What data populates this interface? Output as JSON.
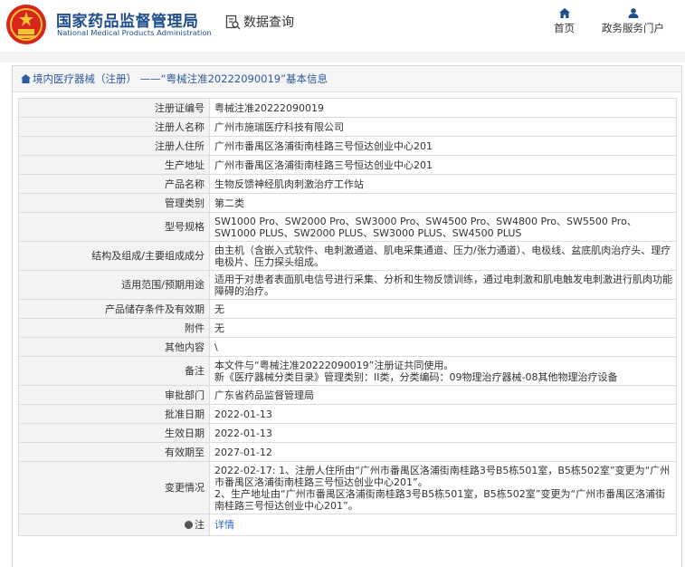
{
  "header": {
    "org_name_cn": "国家药品监督管理局",
    "org_name_en": "National Medical Products Administration",
    "search_label": "数据查询",
    "nav": [
      {
        "label": "首页",
        "icon": "home-icon"
      },
      {
        "label": "政务服务门户",
        "icon": "user-icon"
      }
    ]
  },
  "breadcrumb": "境内医疗器械（注册） ——“粤械注准20222090019”基本信息",
  "colors": {
    "brand_blue": "#1f4e8c",
    "logo_red": "#d7261e",
    "link_blue": "#2b6bc2"
  },
  "rows": [
    {
      "label": "注册证编号",
      "value": "粤械注准20222090019"
    },
    {
      "label": "注册人名称",
      "value": "广州市施瑞医疗科技有限公司"
    },
    {
      "label": "注册人住所",
      "value": "广州市番禺区洛浦街南桂路三号恒达创业中心201"
    },
    {
      "label": "生产地址",
      "value": "广州市番禺区洛浦街南桂路三号恒达创业中心201"
    },
    {
      "label": "产品名称",
      "value": "生物反馈神经肌肉刺激治疗工作站"
    },
    {
      "label": "管理类别",
      "value": "第二类"
    },
    {
      "label": "型号规格",
      "value": "SW1000 Pro、SW2000 Pro、SW3000 Pro、SW4500 Pro、SW4800 Pro、SW5500 Pro、SW1000 PLUS、SW2000 PLUS、SW3000 PLUS、SW4500 PLUS"
    },
    {
      "label": "结构及组成/主要组成成分",
      "value": "由主机（含嵌入式软件、电刺激通道、肌电采集通道、压力/张力通道）、电极线、盆底肌肉治疗头、理疗电极片、压力探头组成。"
    },
    {
      "label": "适用范围/预期用途",
      "value": "适用于对患者表面肌电信号进行采集、分析和生物反馈训练，通过电刺激和肌电触发电刺激进行肌肉功能障碍的治疗。"
    },
    {
      "label": "产品储存条件及有效期",
      "value": "无"
    },
    {
      "label": "附件",
      "value": "无"
    },
    {
      "label": "其他内容",
      "value": "\\"
    },
    {
      "label": "备注",
      "value_lines": [
        "本文件与“粤械注准20222090019”注册证共同使用。",
        "新《医疗器械分类目录》管理类别：II类，分类编码：09物理治疗器械-08其他物理治疗设备"
      ]
    },
    {
      "label": "审批部门",
      "value": "广东省药品监督管理局"
    },
    {
      "label": "批准日期",
      "value": "2022-01-13"
    },
    {
      "label": "生效日期",
      "value": "2022-01-13"
    },
    {
      "label": "有效期至",
      "value": "2027-01-12"
    },
    {
      "label": "变更情况",
      "value_lines": [
        "2022-02-17: 1、注册人住所由“广州市番禺区洛浦街南桂路3号B5栋501室，B5栋502室”变更为“广州市番禺区洛浦街南桂路三号恒达创业中心201”。",
        "2、生产地址由“广州市番禺区洛浦街南桂路3号B5栋501室，B5栋502室”变更为“广州市番禺区洛浦街南桂路三号恒达创业中心201”。"
      ]
    },
    {
      "label": "注",
      "value": "详情",
      "icon": "info-icon"
    }
  ]
}
